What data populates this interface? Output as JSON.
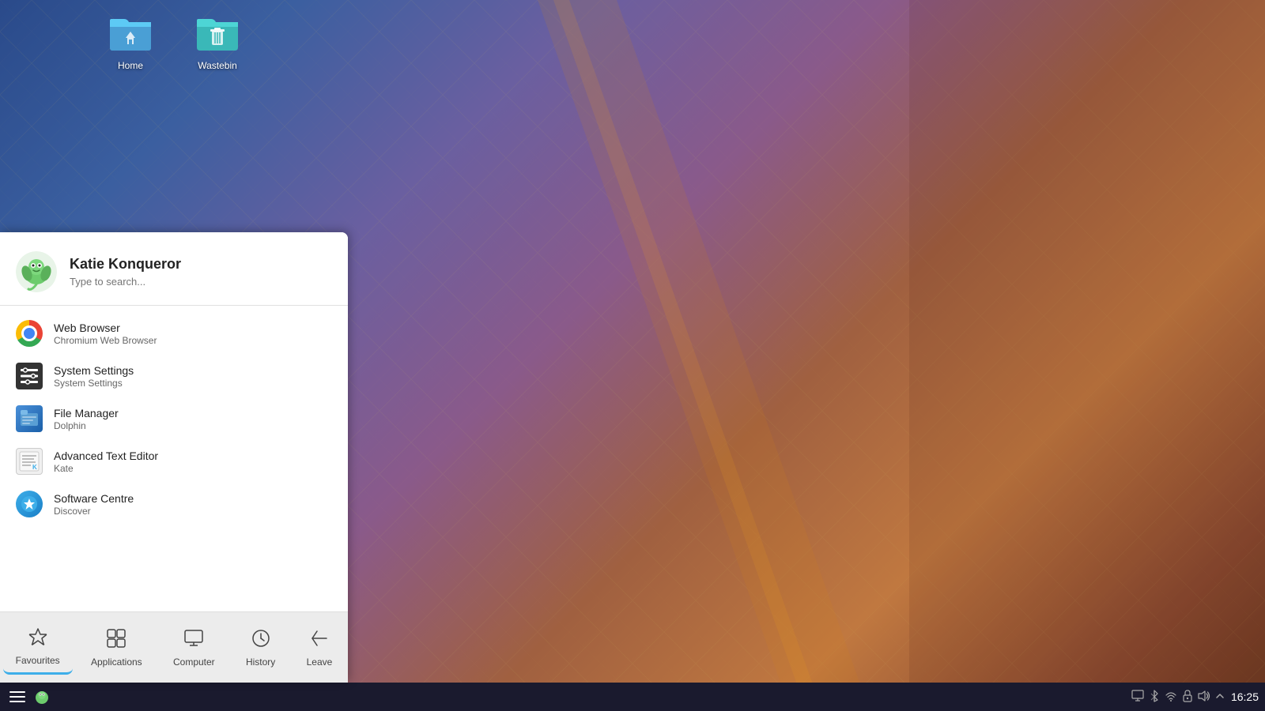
{
  "desktop": {
    "icons": [
      {
        "id": "home",
        "label": "Home",
        "type": "folder-home"
      },
      {
        "id": "wastebin",
        "label": "Wastebin",
        "type": "folder-wastebin"
      }
    ]
  },
  "launcher": {
    "username": "Katie Konqueror",
    "search_placeholder": "Type to search...",
    "apps": [
      {
        "id": "web-browser",
        "name": "Web Browser",
        "desc": "Chromium Web Browser",
        "icon": "chromium"
      },
      {
        "id": "system-settings",
        "name": "System Settings",
        "desc": "System Settings",
        "icon": "settings"
      },
      {
        "id": "file-manager",
        "name": "File Manager",
        "desc": "Dolphin",
        "icon": "dolphin"
      },
      {
        "id": "text-editor",
        "name": "Advanced Text Editor",
        "desc": "Kate",
        "icon": "kate"
      },
      {
        "id": "software-centre",
        "name": "Software Centre",
        "desc": "Discover",
        "icon": "discover"
      }
    ],
    "nav": [
      {
        "id": "favourites",
        "label": "Favourites",
        "icon": "★",
        "active": true
      },
      {
        "id": "applications",
        "label": "Applications",
        "icon": "⊞",
        "active": false
      },
      {
        "id": "computer",
        "label": "Computer",
        "icon": "🖥",
        "active": false
      },
      {
        "id": "history",
        "label": "History",
        "icon": "⏱",
        "active": false
      },
      {
        "id": "leave",
        "label": "Leave",
        "icon": "←",
        "active": false
      }
    ]
  },
  "taskbar": {
    "time": "16:25",
    "tray_icons": [
      "network",
      "bluetooth",
      "wifi",
      "lock",
      "volume",
      "arrow-up"
    ]
  }
}
